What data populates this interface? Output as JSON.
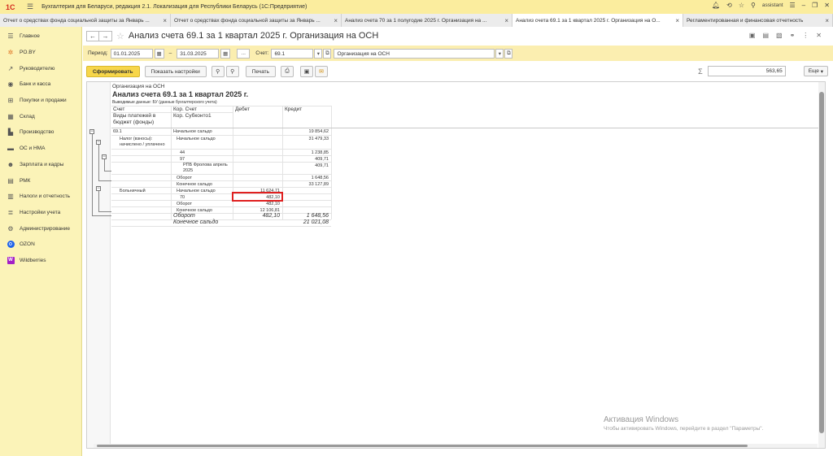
{
  "titlebar": {
    "logo": "1С",
    "menu_icon": "hamburger-icon",
    "title": "Бухгалтерия для Беларуси, редакция 2.1. Локализация для Республики Беларусь   (1С:Предприятие)",
    "user": "assistant"
  },
  "tabs": [
    {
      "label": "Отчет о средствах фонда социальной защиты за Январь ...",
      "active": false
    },
    {
      "label": "Отчет о средствах фонда социальной защиты за Январь ...",
      "active": false
    },
    {
      "label": "Анализ счета 70 за 1 полугодие 2025 г. Организация на ...",
      "active": false
    },
    {
      "label": "Анализ счета 69.1 за 1 квартал 2025 г. Организация на О...",
      "active": true
    },
    {
      "label": "Регламентированная и финансовая отчетность",
      "active": false
    }
  ],
  "sidebar": {
    "items": [
      {
        "label": "Главное",
        "icon": "menu-icon"
      },
      {
        "label": "PO.BY",
        "icon": "sun-icon"
      },
      {
        "label": "Руководителю",
        "icon": "trend-icon"
      },
      {
        "label": "Банк и касса",
        "icon": "bank-icon"
      },
      {
        "label": "Покупки и продажи",
        "icon": "cart-icon"
      },
      {
        "label": "Склад",
        "icon": "warehouse-icon"
      },
      {
        "label": "Производство",
        "icon": "factory-icon"
      },
      {
        "label": "ОС и НМА",
        "icon": "car-icon"
      },
      {
        "label": "Зарплата и кадры",
        "icon": "people-icon"
      },
      {
        "label": "РМК",
        "icon": "register-icon"
      },
      {
        "label": "Налоги и отчетность",
        "icon": "taxes-icon"
      },
      {
        "label": "Настройки учета",
        "icon": "settings-list-icon"
      },
      {
        "label": "Администрирование",
        "icon": "gear-icon"
      },
      {
        "label": "OZON",
        "icon": "ozon-icon"
      },
      {
        "label": "Wildberries",
        "icon": "wildberries-icon"
      }
    ]
  },
  "document": {
    "title": "Анализ счета 69.1 за 1 квартал 2025 г. Организация на ОСН"
  },
  "params": {
    "period_label": "Период:",
    "date_from": "01.01.2025",
    "dash": "–",
    "date_to": "31.03.2025",
    "dots": "...",
    "account_label": "Счет:",
    "account": "69.1",
    "organization": "Организация на ОСН"
  },
  "toolbar": {
    "generate": "Сформировать",
    "show_settings": "Показать настройки",
    "print": "Печать",
    "sum_value": "563,65",
    "more": "Еще"
  },
  "report": {
    "org": "Организация на ОСН",
    "title": "Анализ счета 69.1 за 1 квартал 2025 г.",
    "output": "Выводимые данные:  БУ (данные бухгалтерского учета)",
    "col_account": "Счет",
    "col_kor": "Кор. Счет",
    "col_debit": "Дебет",
    "col_credit": "Кредит",
    "col_subaccount": "Виды платежей в бюджет (фонды)",
    "col_subconto": "Кор. Субконто1",
    "rows": {
      "acc": "69.1",
      "start_saldo": "Начальное сальдо",
      "start_saldo_credit": "19 854,62",
      "tax_label": "Налог (взносы): начислено / уплачено",
      "tax_start_saldo": "Начальное сальдо",
      "tax_start_saldo_credit": "31 479,33",
      "r44": "44",
      "r44_credit": "1 238,85",
      "r97": "97",
      "r97_credit": "409,71",
      "r97_sub": "РПБ Фролова апрель 2025",
      "r97_sub_credit": "409,71",
      "turnover": "Оборот",
      "turnover_credit": "1 648,56",
      "end_saldo": "Конечное сальдо",
      "end_saldo_credit": "33 127,89",
      "sick_label": "Больничный",
      "sick_start_saldo": "Начальное сальдо",
      "sick_start_saldo_debit": "11 624,71",
      "r70": "70",
      "r70_debit": "482,10",
      "sick_turnover": "Оборот",
      "sick_turnover_debit": "482,10",
      "sick_end_saldo": "Конечное сальдо",
      "sick_end_saldo_debit": "12 106,81",
      "total_turnover": "Оборот",
      "total_turnover_debit": "482,10",
      "total_turnover_credit": "1 648,56",
      "total_end_saldo": "Конечное сальдо",
      "total_end_saldo_credit": "21 021,08"
    }
  },
  "watermark": {
    "line1": "Активация Windows",
    "line2": "Чтобы активировать Windows, перейдите в раздел \"Параметры\"."
  }
}
